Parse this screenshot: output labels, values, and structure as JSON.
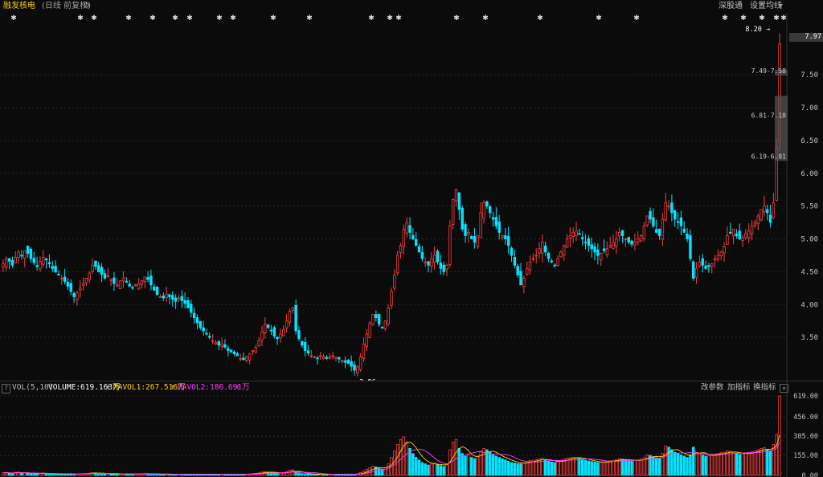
{
  "header": {
    "stock_name": "融发核电",
    "period_label": "(日线 前复权)",
    "gear_icon": "gear-icon",
    "sz_connect_label": "深股通",
    "settings_label": "设置均线",
    "settings_caret": "▾"
  },
  "price_axis": {
    "ticks": [
      "7.50",
      "7.00",
      "6.50",
      "6.00",
      "5.50",
      "5.00",
      "4.50",
      "4.00",
      "3.50"
    ],
    "current_price": "7.97"
  },
  "annotations": {
    "high_label": "8.20",
    "low_label": "2.96",
    "zones": [
      "7.49-7.58",
      "6.81-7.18",
      "6.19-6.81"
    ]
  },
  "volume_panel": {
    "help_label": "?",
    "indicator_name": "VOL(5,10)",
    "volume_label": "VOLUME:619.163万",
    "mavol1_label": "MAVOL1:267.516万",
    "mavol2_label": "MAVOL2:186.691万",
    "change_params": "改参数",
    "add_indicator": "加指标",
    "switch_indicator": "换指标",
    "close_label": "×",
    "axis_ticks": [
      "619.00",
      "456.00",
      "305.00",
      "155.00",
      "0.00"
    ]
  },
  "colors": {
    "up": "#ff3c3c",
    "down": "#00e5ff",
    "ma1": "#ffd200",
    "ma2": "#ff3cff",
    "name": "#f0d000"
  },
  "chart_data": {
    "type": "candlestick",
    "title": "融发核电",
    "ylim": [
      3.0,
      8.2
    ],
    "closes": [
      4.62,
      4.7,
      4.66,
      4.6,
      4.72,
      4.8,
      4.75,
      4.82,
      4.78,
      4.7,
      4.64,
      4.58,
      4.66,
      4.72,
      4.68,
      4.62,
      4.55,
      4.5,
      4.45,
      4.4,
      4.35,
      4.28,
      4.2,
      4.12,
      4.18,
      4.25,
      4.32,
      4.4,
      4.48,
      4.6,
      4.58,
      4.5,
      4.46,
      4.4,
      4.44,
      4.38,
      4.32,
      4.3,
      4.36,
      4.4,
      4.34,
      4.28,
      4.26,
      4.3,
      4.32,
      4.36,
      4.42,
      4.38,
      4.3,
      4.22,
      4.15,
      4.12,
      4.1,
      4.16,
      4.12,
      4.08,
      4.05,
      4.1,
      4.06,
      4.02,
      3.95,
      3.88,
      3.8,
      3.72,
      3.65,
      3.6,
      3.55,
      3.5,
      3.45,
      3.42,
      3.38,
      3.4,
      3.35,
      3.3,
      3.28,
      3.25,
      3.22,
      3.18,
      3.16,
      3.2,
      3.25,
      3.3,
      3.35,
      3.45,
      3.58,
      3.7,
      3.65,
      3.6,
      3.52,
      3.48,
      3.55,
      3.62,
      3.75,
      3.9,
      3.95,
      3.6,
      3.48,
      3.38,
      3.3,
      3.26,
      3.22,
      3.2,
      3.18,
      3.22,
      3.2,
      3.18,
      3.2,
      3.22,
      3.2,
      3.17,
      3.15,
      3.12,
      3.1,
      3.06,
      3.0,
      3.05,
      3.2,
      3.4,
      3.55,
      3.72,
      3.85,
      3.8,
      3.7,
      3.65,
      3.75,
      3.95,
      4.2,
      4.45,
      4.75,
      4.9,
      5.15,
      5.25,
      5.1,
      5.0,
      4.9,
      4.8,
      4.7,
      4.65,
      4.6,
      4.7,
      4.75,
      4.65,
      4.55,
      4.5,
      4.6,
      5.2,
      5.6,
      5.75,
      5.45,
      5.15,
      5.05,
      5.1,
      5.0,
      4.95,
      5.05,
      5.4,
      5.55,
      5.5,
      5.4,
      5.3,
      5.2,
      5.1,
      5.05,
      5.0,
      4.9,
      4.75,
      4.6,
      4.45,
      4.3,
      4.4,
      4.55,
      4.65,
      4.7,
      4.75,
      4.85,
      4.95,
      4.8,
      4.7,
      4.65,
      4.6,
      4.7,
      4.8,
      4.9,
      5.0,
      5.05,
      5.1,
      5.12,
      5.08,
      5.0,
      4.95,
      4.9,
      4.85,
      4.8,
      4.75,
      4.78,
      4.82,
      4.85,
      4.9,
      4.95,
      5.0,
      5.1,
      5.05,
      5.0,
      4.95,
      4.92,
      4.95,
      5.0,
      5.05,
      5.2,
      5.35,
      5.3,
      5.2,
      5.1,
      5.05,
      5.3,
      5.55,
      5.5,
      5.4,
      5.3,
      5.25,
      5.2,
      5.1,
      5.0,
      4.7,
      4.4,
      4.55,
      4.65,
      4.6,
      4.55,
      4.58,
      4.62,
      4.7,
      4.75,
      4.8,
      4.88,
      5.05,
      5.1,
      5.15,
      5.05,
      5.0,
      5.02,
      5.08,
      5.12,
      5.2,
      5.25,
      5.35,
      5.45,
      5.5,
      5.4,
      5.25,
      5.55,
      6.4,
      7.97
    ],
    "volumes": [
      20,
      22,
      18,
      15,
      24,
      26,
      20,
      18,
      16,
      15,
      14,
      13,
      16,
      18,
      15,
      14,
      12,
      12,
      11,
      10,
      10,
      12,
      14,
      12,
      11,
      13,
      14,
      16,
      18,
      22,
      20,
      16,
      14,
      12,
      13,
      12,
      11,
      10,
      12,
      13,
      11,
      10,
      10,
      11,
      12,
      13,
      15,
      14,
      12,
      10,
      9,
      9,
      8,
      9,
      9,
      8,
      8,
      9,
      9,
      8,
      8,
      9,
      10,
      9,
      9,
      8,
      8,
      9,
      8,
      8,
      8,
      9,
      9,
      8,
      8,
      8,
      8,
      9,
      9,
      10,
      12,
      14,
      16,
      20,
      26,
      30,
      26,
      22,
      18,
      16,
      18,
      22,
      30,
      40,
      44,
      24,
      18,
      14,
      12,
      10,
      10,
      9,
      9,
      10,
      9,
      9,
      9,
      10,
      9,
      9,
      9,
      8,
      9,
      9,
      10,
      14,
      22,
      34,
      48,
      60,
      72,
      66,
      56,
      50,
      62,
      90,
      140,
      190,
      240,
      280,
      300,
      260,
      210,
      170,
      140,
      120,
      100,
      90,
      80,
      88,
      94,
      84,
      76,
      70,
      90,
      200,
      260,
      280,
      210,
      170,
      150,
      160,
      140,
      130,
      150,
      190,
      210,
      200,
      180,
      160,
      150,
      140,
      130,
      120,
      110,
      100,
      96,
      92,
      90,
      98,
      108,
      114,
      118,
      120,
      128,
      134,
      120,
      110,
      104,
      100,
      108,
      118,
      126,
      134,
      138,
      142,
      140,
      134,
      126,
      118,
      112,
      108,
      104,
      100,
      102,
      106,
      110,
      114,
      118,
      122,
      130,
      126,
      120,
      116,
      112,
      116,
      120,
      126,
      138,
      160,
      156,
      146,
      136,
      130,
      170,
      230,
      220,
      200,
      180,
      170,
      160,
      150,
      140,
      160,
      220,
      180,
      168,
      158,
      150,
      152,
      156,
      164,
      170,
      176,
      180,
      190,
      186,
      180,
      170,
      164,
      166,
      172,
      178,
      184,
      190,
      200,
      210,
      216,
      200,
      190,
      240,
      320,
      619
    ],
    "ma1": [],
    "ma2": [],
    "volume_unit": "万"
  }
}
